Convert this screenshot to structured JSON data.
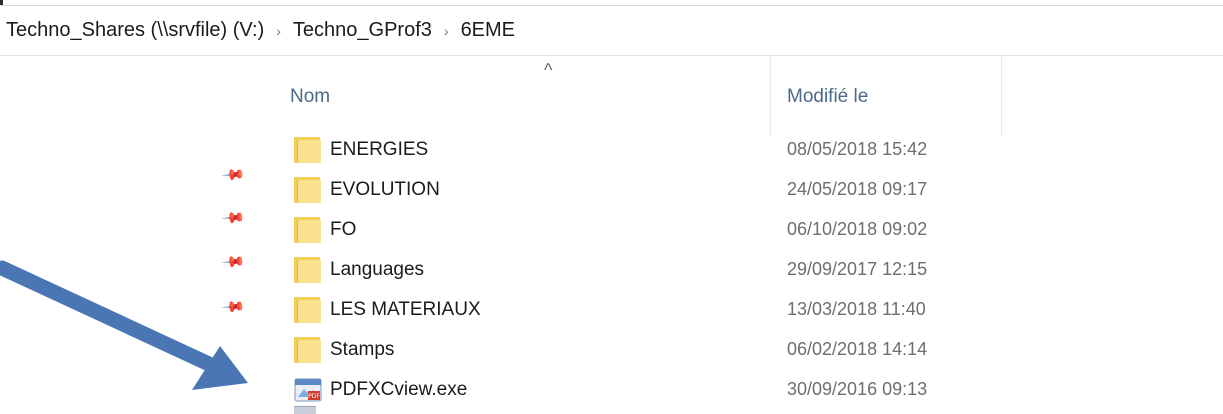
{
  "breadcrumb": {
    "items": [
      "Techno_Shares (\\\\srvfile) (V:)",
      "Techno_GProf3",
      "6EME"
    ],
    "separator": "›"
  },
  "columns": {
    "name_label": "Nom",
    "date_label": "Modifié le",
    "sort_indicator": "^"
  },
  "files": [
    {
      "name": "ENERGIES",
      "modified": "08/05/2018 15:42",
      "type": "folder",
      "pinned": true
    },
    {
      "name": "EVOLUTION",
      "modified": "24/05/2018 09:17",
      "type": "folder",
      "pinned": true
    },
    {
      "name": "FO",
      "modified": "06/10/2018 09:02",
      "type": "folder",
      "pinned": true
    },
    {
      "name": "Languages",
      "modified": "29/09/2017 12:15",
      "type": "folder",
      "pinned": true
    },
    {
      "name": "LES MATERIAUX",
      "modified": "13/03/2018 11:40",
      "type": "folder",
      "pinned": false
    },
    {
      "name": "Stamps",
      "modified": "06/02/2018 14:14",
      "type": "folder",
      "pinned": false
    },
    {
      "name": "PDFXCview.exe",
      "modified": "30/09/2016 09:13",
      "type": "exe",
      "pinned": false
    }
  ],
  "colors": {
    "folder": "#f5cf5b",
    "annotation_arrow": "#4a77b4",
    "header_text": "#4c6a8a"
  },
  "icons": {
    "folder": "folder-icon",
    "exe": "pdf-viewer-app-icon",
    "pin": "pin-icon"
  }
}
